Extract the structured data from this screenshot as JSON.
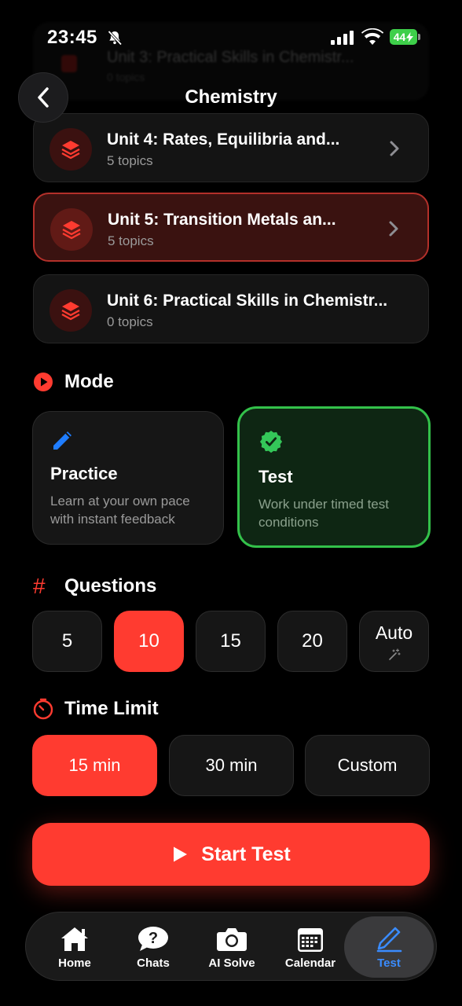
{
  "status_bar": {
    "time": "23:45",
    "battery": "44"
  },
  "header": {
    "title": "Chemistry",
    "ghost_unit_title": "Unit 3: Practical Skills in Chemistr...",
    "ghost_unit_sub": "0 topics"
  },
  "units": [
    {
      "title": "Unit 4: Rates, Equilibria and...",
      "topics": "5 topics"
    },
    {
      "title": "Unit 5: Transition Metals an...",
      "topics": "5 topics"
    },
    {
      "title": "Unit 6: Practical Skills in Chemistr...",
      "topics": "0 topics"
    }
  ],
  "mode": {
    "label": "Mode",
    "practice": {
      "title": "Practice",
      "desc": "Learn at your own pace with instant feedback"
    },
    "test": {
      "title": "Test",
      "desc": "Work under timed test conditions"
    }
  },
  "questions": {
    "label": "Questions",
    "options": [
      "5",
      "10",
      "15",
      "20",
      "Auto"
    ]
  },
  "time_limit": {
    "label": "Time Limit",
    "options": [
      "15 min",
      "30 min",
      "Custom"
    ]
  },
  "start_button": {
    "label": "Start Test"
  },
  "tab_bar": {
    "items": [
      {
        "label": "Home"
      },
      {
        "label": "Chats"
      },
      {
        "label": "AI Solve"
      },
      {
        "label": "Calendar"
      },
      {
        "label": "Test"
      }
    ]
  },
  "colors": {
    "accent_red": "#ff3b30",
    "selected_green": "#33c14a",
    "active_tab_blue": "#3a8cff",
    "battery_green": "#3ecf4a"
  }
}
